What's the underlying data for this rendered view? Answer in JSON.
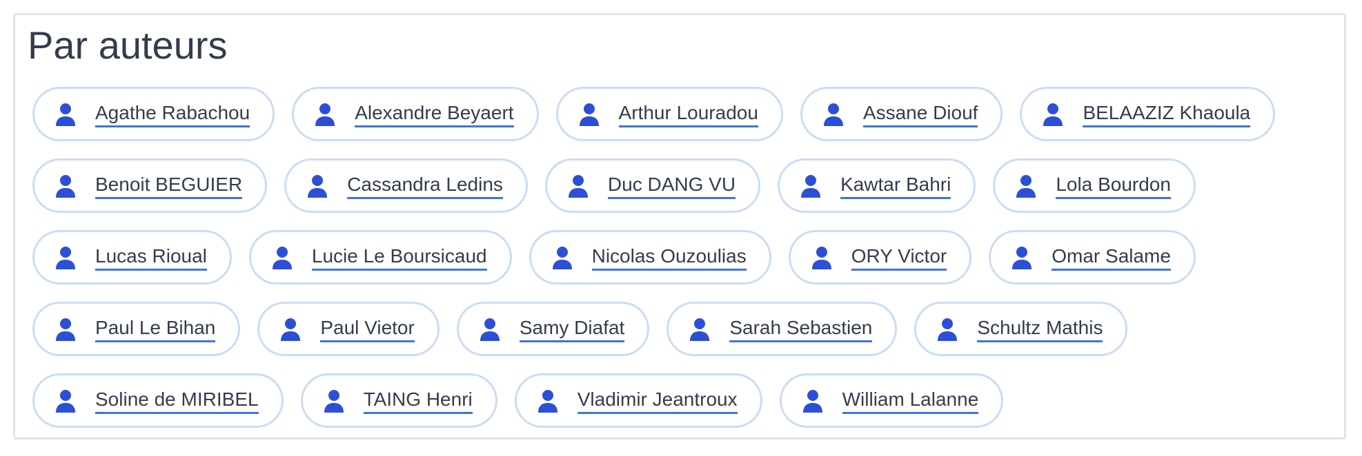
{
  "section": {
    "title": "Par auteurs"
  },
  "colors": {
    "icon": "#2c4fd6",
    "text": "#333c4d",
    "chip_border": "#c9dcf7",
    "underline": "#3f72e0",
    "panel_border": "#e4e4e4"
  },
  "icons": {
    "author": "user-icon"
  },
  "authors": [
    "Agathe Rabachou",
    "Alexandre Beyaert",
    "Arthur Louradou",
    "Assane Diouf",
    "BELAAZIZ Khaoula",
    "Benoit BEGUIER",
    "Cassandra Ledins",
    "Duc DANG VU",
    "Kawtar Bahri",
    "Lola Bourdon",
    "Lucas Rioual",
    "Lucie Le Boursicaud",
    "Nicolas Ouzoulias",
    "ORY Victor",
    "Omar Salame",
    "Paul Le Bihan",
    "Paul Vietor",
    "Samy Diafat",
    "Sarah Sebastien",
    "Schultz Mathis",
    "Soline de MIRIBEL",
    "TAING Henri",
    "Vladimir Jeantroux",
    "William Lalanne"
  ]
}
